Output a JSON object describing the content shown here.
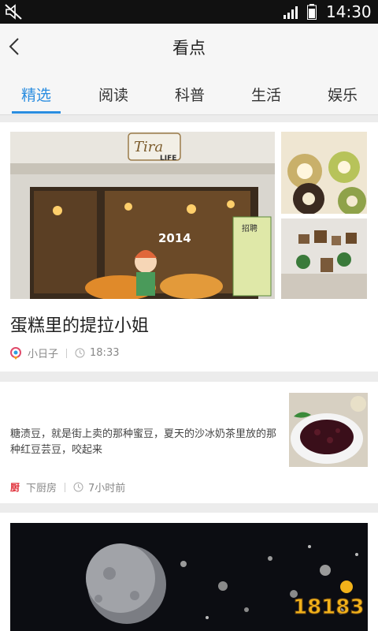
{
  "status_bar": {
    "time": "14:30",
    "icons": [
      "mute-icon",
      "signal-icon",
      "battery-icon"
    ]
  },
  "header": {
    "title": "看点",
    "back_icon": "chevron-left-icon"
  },
  "tabs": [
    {
      "label": "精选",
      "active": true
    },
    {
      "label": "阅读",
      "active": false
    },
    {
      "label": "科普",
      "active": false
    },
    {
      "label": "生活",
      "active": false
    },
    {
      "label": "娱乐",
      "active": false
    }
  ],
  "feed": [
    {
      "title": "蛋糕里的提拉小姐",
      "source": "小日子",
      "time": "18:33",
      "image_text": {
        "shop_sign": "Tira",
        "shop_sign_sub": "LIFE",
        "year": "2014",
        "poster": "招聘"
      }
    },
    {
      "description": "糖渍豆，就是街上卖的那种蜜豆，夏天的沙冰奶茶里放的那种红豆芸豆，咬起来",
      "source": "下厨房",
      "source_icon_text": "厨",
      "time": "7小时前"
    },
    {
      "image": "space-asteroids"
    }
  ],
  "watermark": "18183",
  "colors": {
    "accent": "#2a8de0",
    "statusbar": "#111111",
    "background": "#ececec"
  }
}
